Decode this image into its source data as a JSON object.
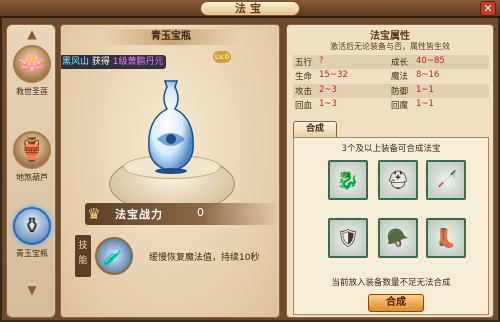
{
  "window": {
    "title": "法宝",
    "close_icon": "close-icon"
  },
  "sidebar": {
    "items": [
      {
        "label": "救世圣莲",
        "icon": "lotus-icon",
        "selected": false
      },
      {
        "label": "地煞葫芦",
        "icon": "gourd-icon",
        "selected": false
      },
      {
        "label": "青玉宝瓶",
        "icon": "vase-icon",
        "selected": true
      }
    ],
    "up_icon": "chevron-up-icon",
    "down_icon": "chevron-down-icon"
  },
  "item_view": {
    "name": "青玉宝瓶",
    "level_badge": "Lv.0",
    "notice": {
      "player": "黑风山",
      "action": " 获得 ",
      "item": "1级萧鹏丹元"
    }
  },
  "power": {
    "label": "法宝战力",
    "value": "0"
  },
  "skill": {
    "tab_label": "技能",
    "description": "缓慢恢复魔法值，持续10秒"
  },
  "attributes": {
    "title": "法宝属性",
    "subtitle": "激活后无论装备与否，属性皆生效",
    "rows": [
      {
        "k1": "五行",
        "v1": "?",
        "k2": "成长",
        "v2": "40~85"
      },
      {
        "k1": "生命",
        "v1": "15~32",
        "k2": "魔法",
        "v2": "8~16"
      },
      {
        "k1": "攻击",
        "v1": "2~3",
        "k2": "防御",
        "v2": "1~1"
      },
      {
        "k1": "回血",
        "v1": "1~3",
        "k2": "回魔",
        "v2": "1~1"
      }
    ]
  },
  "compose": {
    "tab_label": "合成",
    "hint": "3个及以上装备可合成法宝",
    "warning": "当前放入装备数量不足无法合成",
    "button_label": "合成",
    "slots": [
      {
        "icon": "dragon-armor-icon"
      },
      {
        "icon": "helmet-icon"
      },
      {
        "icon": "staff-icon"
      },
      {
        "icon": "chest-armor-icon"
      },
      {
        "icon": "shoulder-guard-icon"
      },
      {
        "icon": "boots-icon"
      }
    ]
  },
  "colors": {
    "accent_red": "#c42b1a",
    "frame_brown": "#6b4a2d",
    "selected_blue": "#2c6bc1"
  }
}
